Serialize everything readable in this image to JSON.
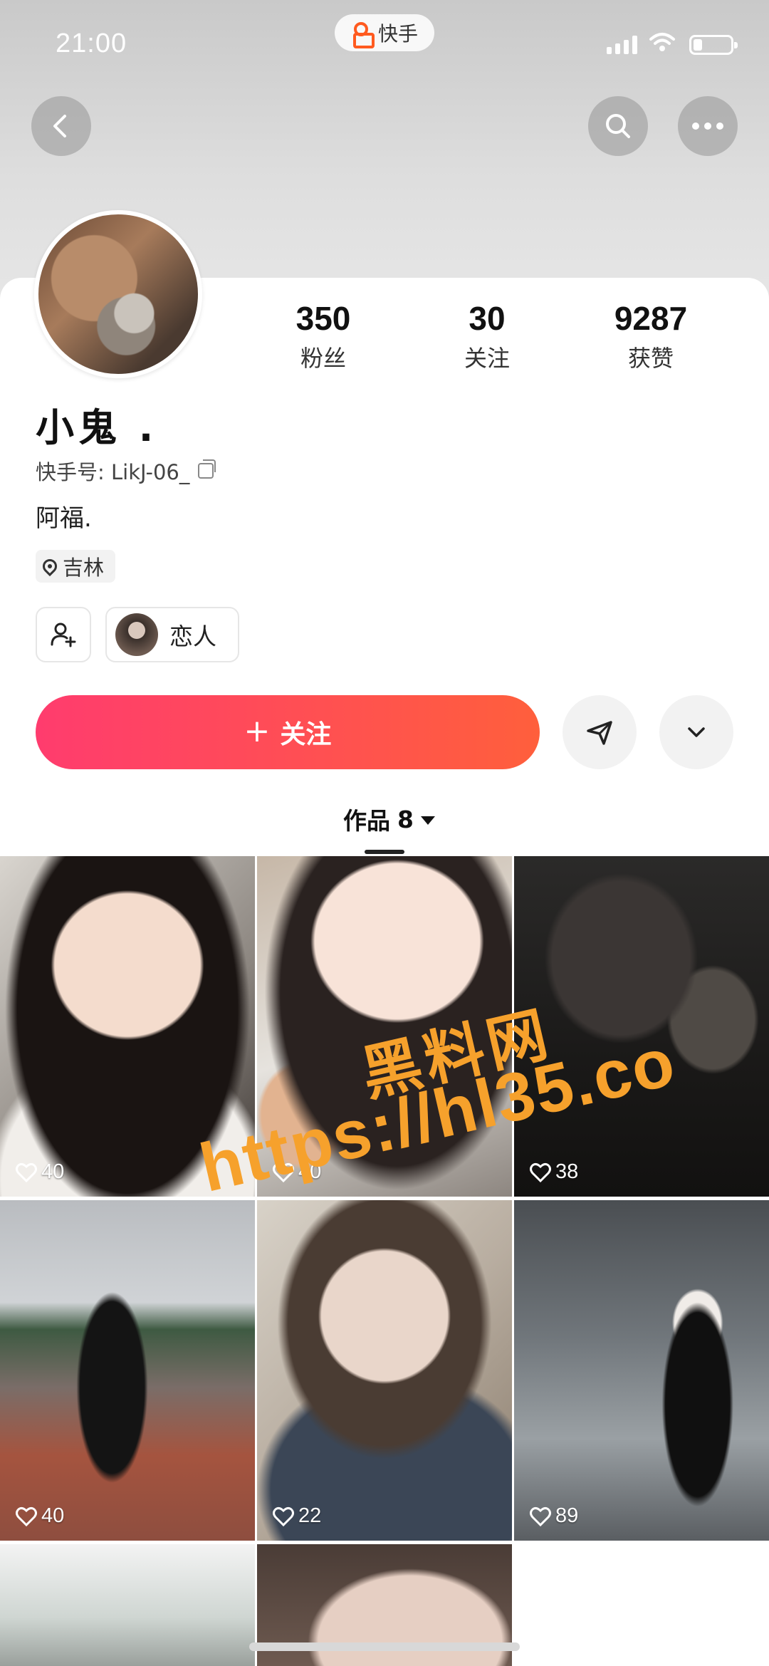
{
  "status_bar": {
    "time": "21:00",
    "app_name": "快手"
  },
  "nav": {
    "back_icon": "chevron-left-icon",
    "search_icon": "search-icon",
    "more_icon": "more-horizontal-icon"
  },
  "profile": {
    "name": "小鬼 .",
    "kuaishou_id": "快手号: LikJ-06_",
    "bio": "阿福.",
    "location": "吉林",
    "stats": [
      {
        "value": "350",
        "label": "粉丝"
      },
      {
        "value": "30",
        "label": "关注"
      },
      {
        "value": "9287",
        "label": "获赞"
      }
    ],
    "relation_chip": "恋人"
  },
  "actions": {
    "follow_label": "关注",
    "follow_icon": "+"
  },
  "tabs": {
    "works_label": "作品",
    "works_count": "8"
  },
  "grid": [
    {
      "likes": "40"
    },
    {
      "likes": "40"
    },
    {
      "likes": "38"
    },
    {
      "likes": "40"
    },
    {
      "likes": "22"
    },
    {
      "likes": "89"
    }
  ],
  "watermark": {
    "line1": "黑料网",
    "line2": "https://hl35.co"
  },
  "colors": {
    "accent_start": "#ff3c6e",
    "accent_end": "#ff5f3c",
    "brand": "#ff5a1f",
    "watermark": "#f6a12c"
  }
}
